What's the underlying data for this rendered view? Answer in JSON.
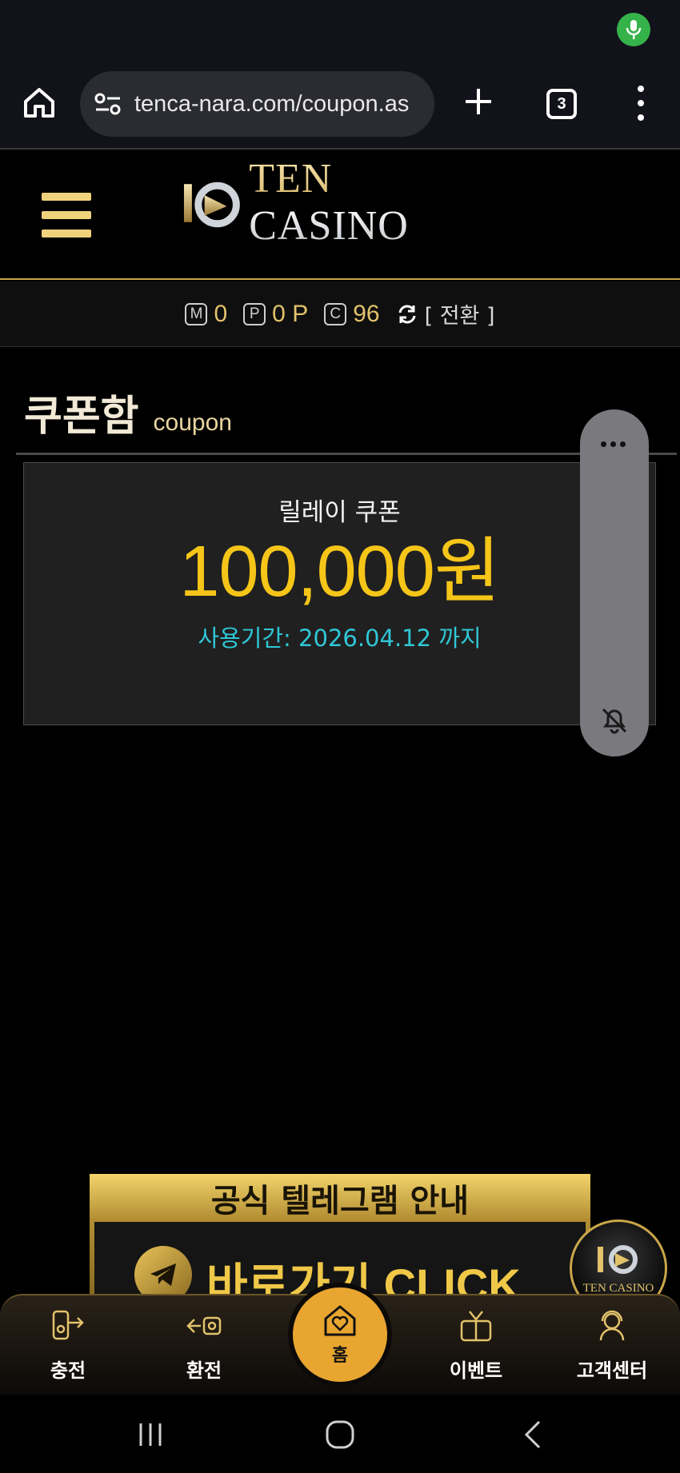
{
  "browser": {
    "url": "tenca-nara.com/coupon.as",
    "tab_count": "3"
  },
  "site": {
    "logo_text_1": "TEN ",
    "logo_text_2": "CASINO"
  },
  "points": {
    "m_label": "M",
    "m_value": "0",
    "p_label": "P",
    "p_value": "0 P",
    "c_label": "C",
    "c_value": "96",
    "switch_label": "[ 전환 ]"
  },
  "page": {
    "title_ko": "쿠폰함",
    "title_en": "coupon"
  },
  "coupon": {
    "name": "릴레이 쿠폰",
    "amount": "100,000원",
    "period": "사용기간: 2026.04.12 까지",
    "amount_color": "#f5c518",
    "period_color": "#2fc7d6"
  },
  "banner": {
    "title": "공식 텔레그램 안내",
    "cta": "바로가기 CLICK"
  },
  "float_logo": {
    "text": "TEN CASINO"
  },
  "bottom_nav": {
    "charge": "충전",
    "exchange": "환전",
    "home": "홈",
    "event": "이벤트",
    "support": "고객센터"
  },
  "colors": {
    "accent_gold": "#e2c26a",
    "home_button": "#e8a530"
  }
}
